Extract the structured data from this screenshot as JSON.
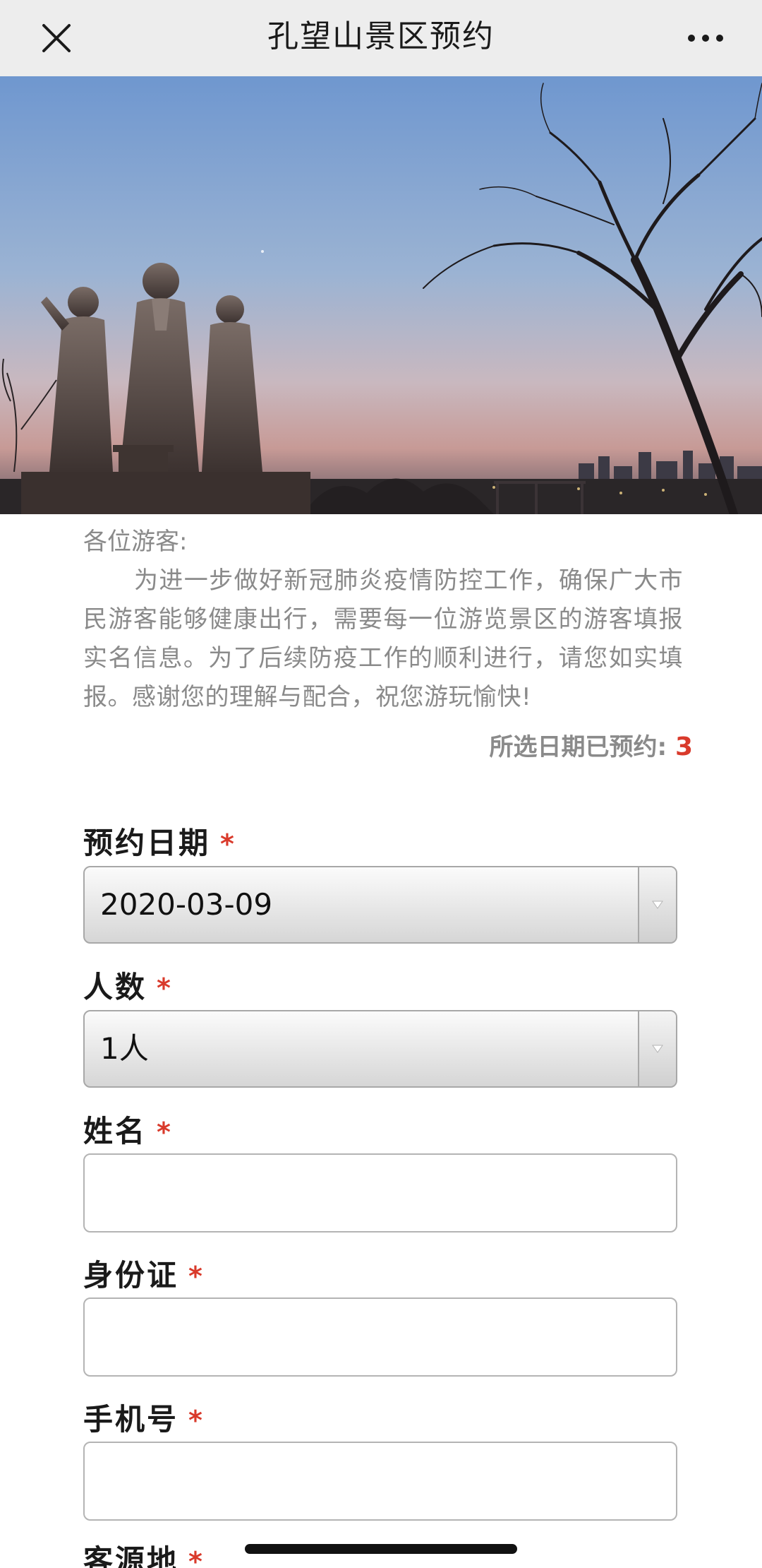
{
  "navbar": {
    "title": "孔望山景区预约",
    "close_icon": "close-icon",
    "more_icon": "more-dots-icon"
  },
  "notice": {
    "greeting": "各位游客:",
    "body": "为进一步做好新冠肺炎疫情防控工作，确保广大市民游客能够健康出行，需要每一位游览景区的游客填报实名信息。为了后续防疫工作的顺利进行，请您如实填报。感谢您的理解与配合，祝您游玩愉快!"
  },
  "booked": {
    "label": "所选日期已预约:",
    "count": "3"
  },
  "form": {
    "required_mark": "*",
    "date": {
      "label": "预约日期",
      "value": "2020-03-09"
    },
    "people": {
      "label": "人数",
      "value": "1人"
    },
    "name": {
      "label": "姓名",
      "value": ""
    },
    "id_card": {
      "label": "身份证",
      "value": ""
    },
    "phone": {
      "label": "手机号",
      "value": ""
    },
    "origin": {
      "label": "客源地"
    }
  },
  "colors": {
    "accent_red": "#d93a2b",
    "navbar_bg": "#ededed",
    "muted_text": "#8a8a8a"
  }
}
